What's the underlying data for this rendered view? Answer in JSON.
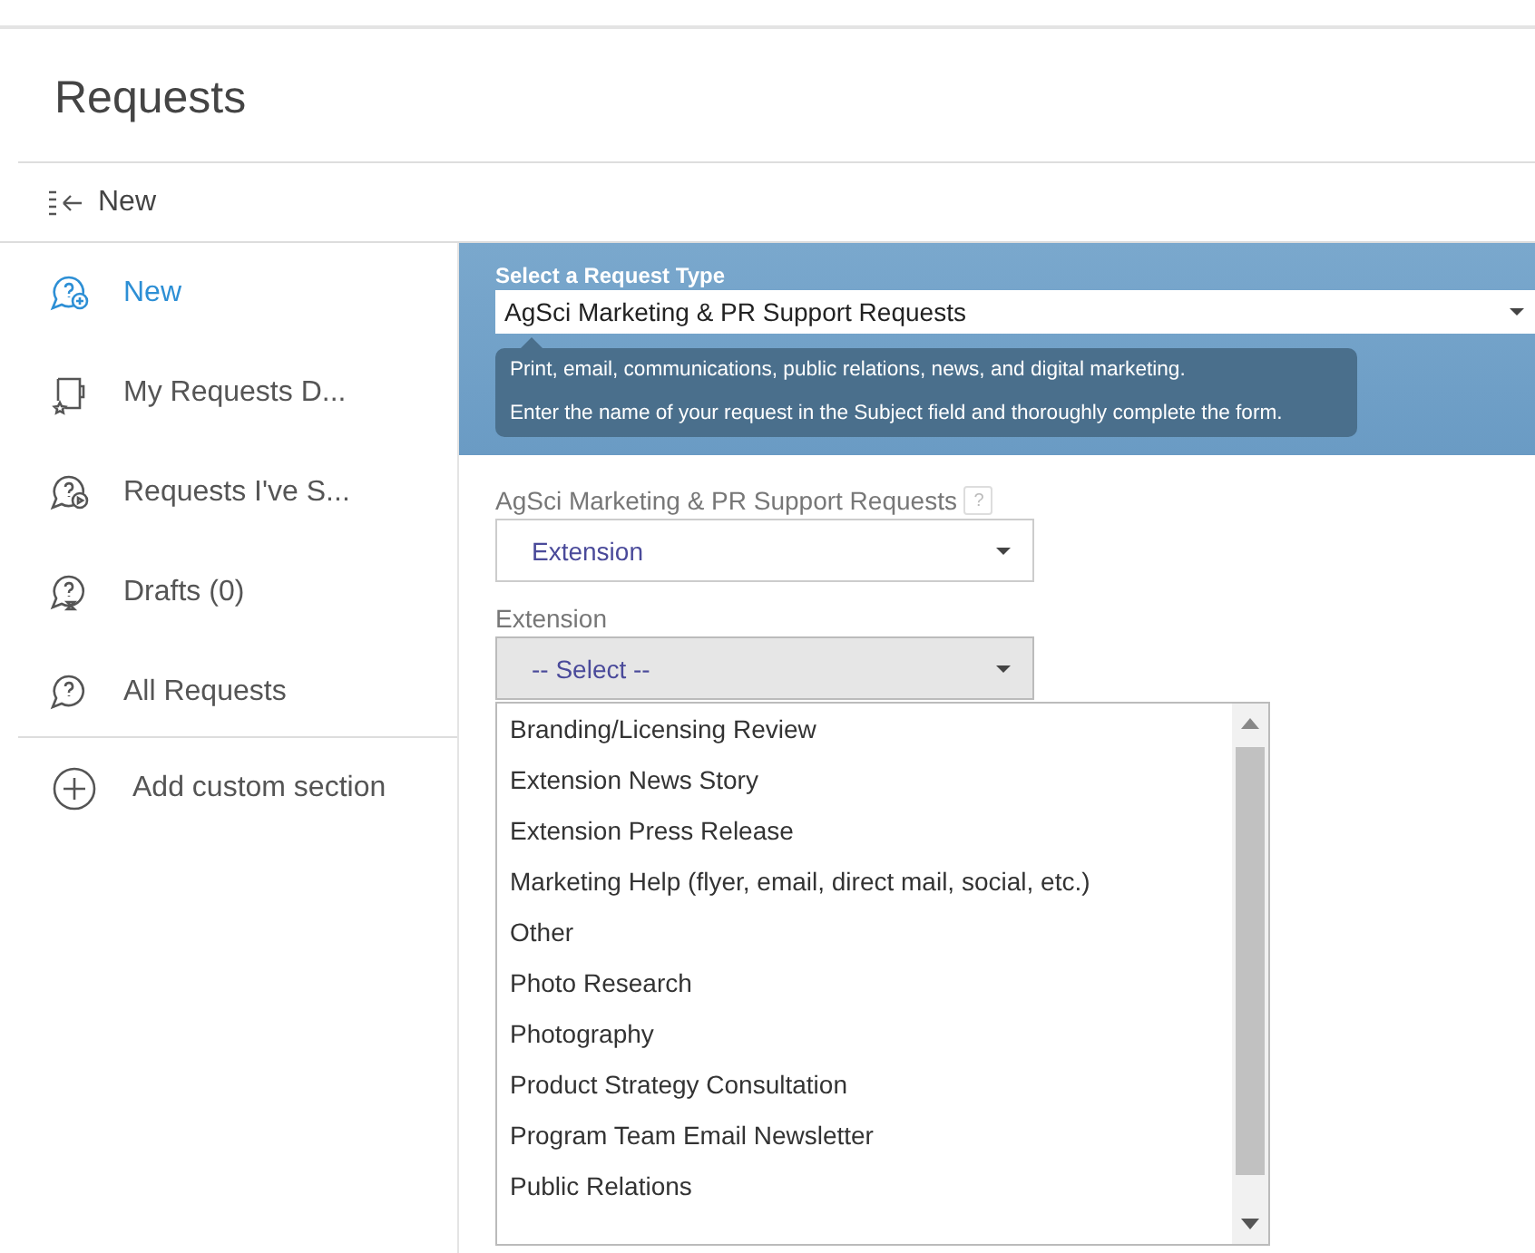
{
  "page": {
    "title": "Requests"
  },
  "toolbar": {
    "label": "New"
  },
  "sidebar": {
    "items": [
      {
        "label": "New",
        "selected": true
      },
      {
        "label": "My Requests D...",
        "selected": false
      },
      {
        "label": "Requests I've S...",
        "selected": false
      },
      {
        "label": "Drafts (0)",
        "selected": false
      },
      {
        "label": "All Requests",
        "selected": false
      }
    ],
    "add_section": "Add custom section"
  },
  "request_type": {
    "label": "Select a Request Type",
    "value": "AgSci Marketing & PR Support Requests",
    "tooltip": [
      "Print, email, communications, public relations, news, and digital marketing.",
      "Enter the name of your request in the Subject field and thoroughly complete the form."
    ]
  },
  "category_field": {
    "label": "AgSci Marketing & PR Support Requests",
    "help": "?",
    "value": "Extension"
  },
  "extension_field": {
    "label": "Extension",
    "value": "-- Select --",
    "expanded": true,
    "options": [
      "Branding/Licensing Review",
      "Extension News Story",
      "Extension Press Release",
      "Marketing Help (flyer, email, direct mail, social, etc.)",
      "Other",
      "Photo Research",
      "Photography",
      "Product Strategy Consultation",
      "Program Team Email Newsletter",
      "Public Relations"
    ]
  }
}
